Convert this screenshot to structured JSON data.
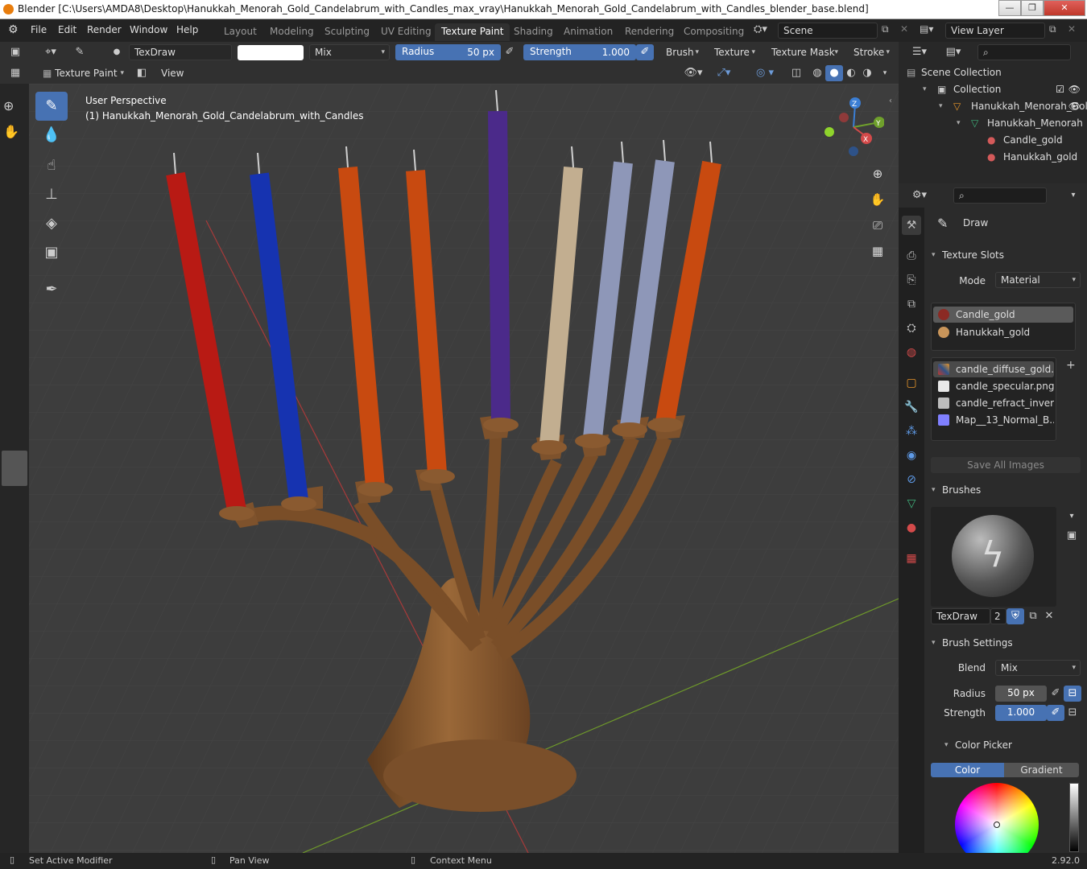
{
  "window": {
    "title": "Blender [C:\\Users\\AMDA8\\Desktop\\Hanukkah_Menorah_Gold_Candelabrum_with_Candles_max_vray\\Hanukkah_Menorah_Gold_Candelabrum_with_Candles_blender_base.blend]",
    "minimize": "—",
    "maximize": "❐",
    "close": "✕"
  },
  "menu": {
    "items": [
      "File",
      "Edit",
      "Render",
      "Window",
      "Help"
    ],
    "workspaces": [
      "Layout",
      "Modeling",
      "Sculpting",
      "UV Editing",
      "Texture Paint",
      "Shading",
      "Animation",
      "Rendering",
      "Compositing"
    ],
    "active_workspace": "Texture Paint",
    "scene": "Scene",
    "view_layer": "View Layer"
  },
  "tool_header": {
    "brush_name": "TexDraw",
    "blend": "Mix",
    "radius_label": "Radius",
    "radius_value": "50 px",
    "strength_label": "Strength",
    "strength_value": "1.000",
    "brush_menu": "Brush",
    "texture_menu": "Texture",
    "texture_mask_menu": "Texture Mask",
    "stroke_menu": "Stroke",
    "color_swatch": "#ffffff"
  },
  "view_header": {
    "mode": "Texture Paint",
    "view_menu": "View"
  },
  "viewport": {
    "perspective": "User Perspective",
    "object": "(1) Hanukkah_Menorah_Gold_Candelabrum_with_Candles",
    "gizmo": {
      "z": "Z",
      "y": "Y",
      "x": "X"
    }
  },
  "outliner": {
    "root": "Scene Collection",
    "rows": [
      {
        "label": "Collection"
      },
      {
        "label": "Hanukkah_Menorah_Gold_Candelabrum_with_Candles"
      },
      {
        "label": "Hanukkah_Menorah"
      },
      {
        "label": "Candle_gold"
      },
      {
        "label": "Hanukkah_gold"
      }
    ]
  },
  "properties": {
    "tool_name": "Draw",
    "texture_slots_title": "Texture Slots",
    "mode_label": "Mode",
    "mode_value": "Material",
    "materials": [
      "Candle_gold",
      "Hanukkah_gold"
    ],
    "images": [
      "candle_diffuse_gold...",
      "candle_specular.png",
      "candle_refract_inver...",
      "Map__13_Normal_B..."
    ],
    "save_all": "Save All Images",
    "brushes_title": "Brushes",
    "brush_name": "TexDraw",
    "brush_users": "2",
    "brush_settings_title": "Brush Settings",
    "blend_label": "Blend",
    "blend_value": "Mix",
    "radius_label": "Radius",
    "radius_value": "50 px",
    "strength_label": "Strength",
    "strength_value": "1.000",
    "color_picker_title": "Color Picker",
    "color_tab": "Color",
    "gradient_tab": "Gradient"
  },
  "status": {
    "left": "Set Active Modifier",
    "middle": "Pan View",
    "right": "Context Menu",
    "version": "2.92.0"
  },
  "colors": {
    "accent": "#4772b3",
    "candles": [
      "#b81a14",
      "#1633b0",
      "#c84a10",
      "#c84a10",
      "#4b2a8a",
      "#c2ae90",
      "#8e97b8",
      "#8e97b8",
      "#c84a10"
    ],
    "menorah": "#8a5a30"
  }
}
